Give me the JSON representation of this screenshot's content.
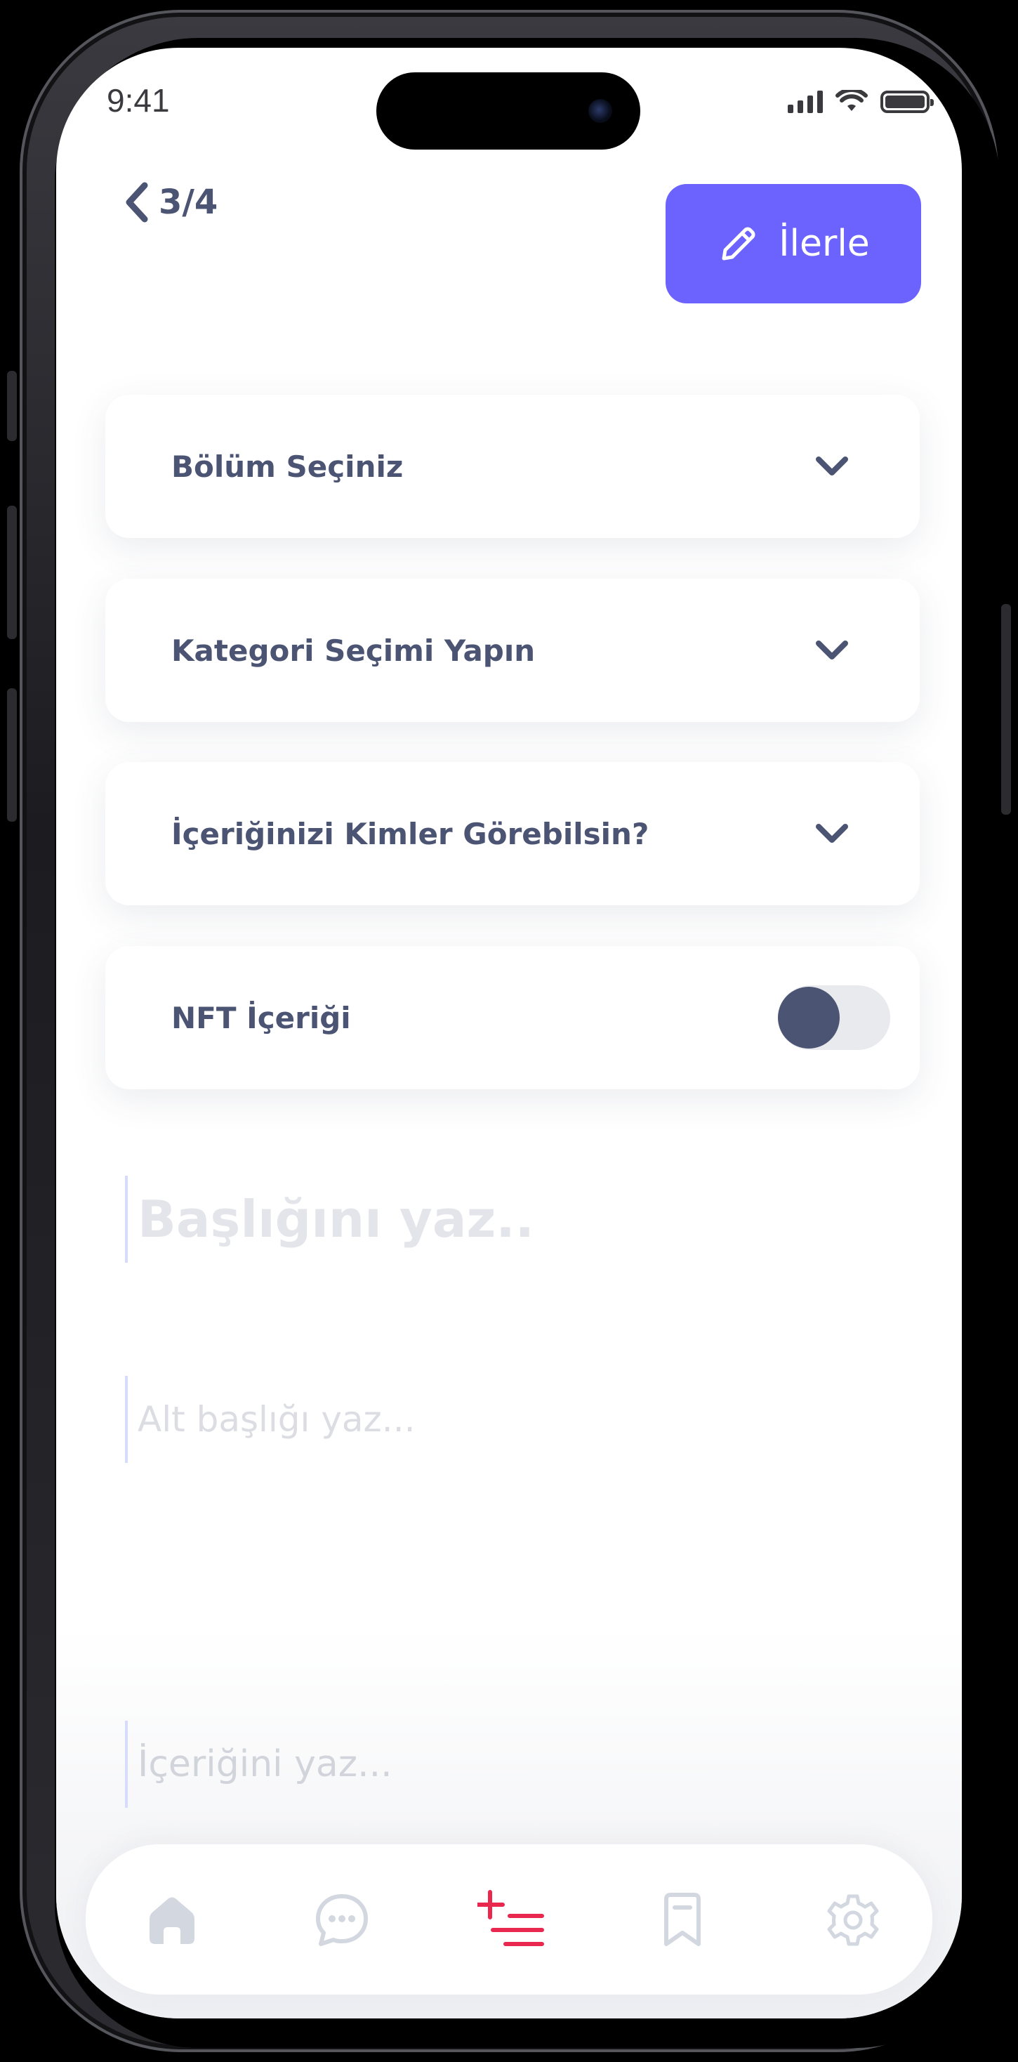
{
  "status_bar": {
    "time": "9:41"
  },
  "header": {
    "step": "3/4",
    "next_label": "İlerle"
  },
  "dropdowns": [
    {
      "label": "Bölüm Seçiniz"
    },
    {
      "label": "Kategori Seçimi Yapın"
    },
    {
      "label": "İçeriğinizi Kimler Görebilsin?"
    }
  ],
  "nft_toggle": {
    "label": "NFT İçeriği",
    "on": false
  },
  "editor": {
    "title_placeholder": "Başlığını yaz..",
    "subtitle_placeholder": "Alt başlığı yaz...",
    "body_placeholder": "İçeriğini yaz..."
  },
  "bottom_nav": {
    "items": [
      {
        "icon": "home-icon"
      },
      {
        "icon": "chat-bubble-icon"
      },
      {
        "icon": "add-post-icon",
        "active": true
      },
      {
        "icon": "bookmark-icon"
      },
      {
        "icon": "settings-gear-icon"
      }
    ]
  },
  "colors": {
    "accent": "#6c63ff",
    "text_primary": "#4b5472",
    "active_nav": "#e8284f",
    "inactive_nav": "#d3d7e0"
  }
}
